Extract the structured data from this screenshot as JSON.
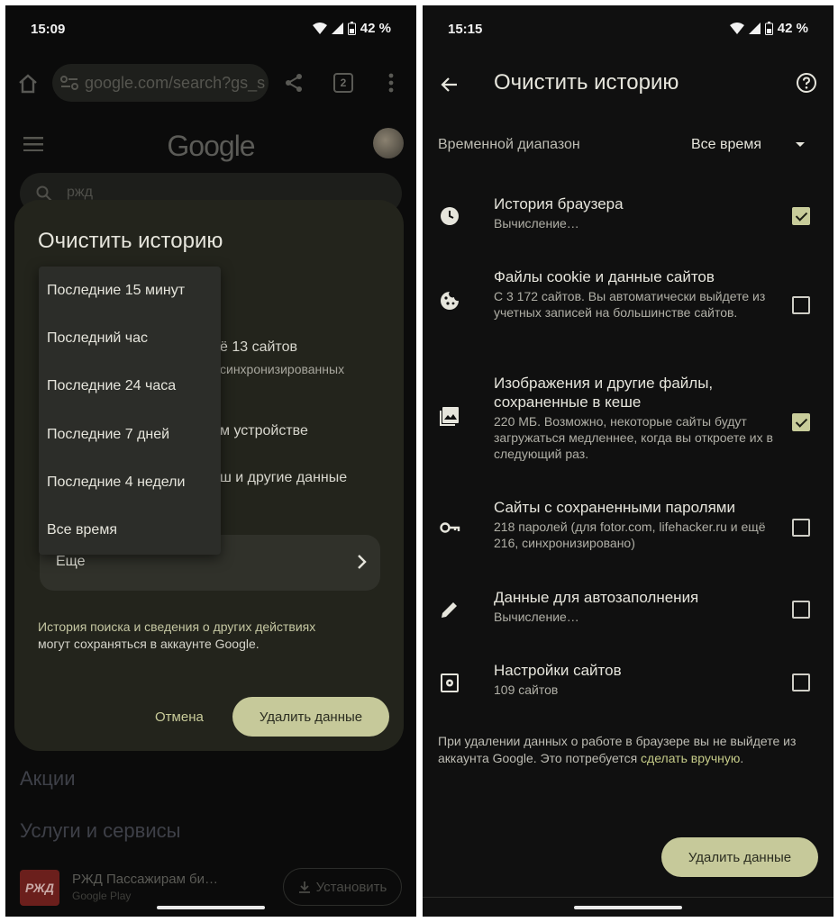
{
  "left": {
    "status": {
      "time": "15:09",
      "battery": "42 %"
    },
    "url": "google.com/search?gs_s",
    "tab_count": "2",
    "google_logo": "Google",
    "search_query": "ржд",
    "dialog": {
      "title": "Очистить историю",
      "peek_texts": [
        "ё 13 сайтов",
        "синхронизированных",
        "м устройстве",
        "ш и другие данные"
      ],
      "more_label": "Еще",
      "note_line1": "История поиска и сведения о других действиях",
      "note_line2": "могут сохраняться в аккаунте Google.",
      "cancel_label": "Отмена",
      "delete_label": "Удалить данные"
    },
    "dropdown_options": [
      "Последние 15 минут",
      "Последний час",
      "Последние 24 часа",
      "Последние 7 дней",
      "Последние 4 недели",
      "Все время"
    ],
    "sections": [
      "Акции",
      "Услуги и сервисы"
    ],
    "app_card": {
      "logo_text": "РЖД",
      "title": "РЖД Пассажирам би…",
      "subtitle": "Google Play",
      "install_label": "Установить"
    }
  },
  "right": {
    "status": {
      "time": "15:15",
      "battery": "42 %"
    },
    "title": "Очистить историю",
    "range_label": "Временной диапазон",
    "range_value": "Все время",
    "items": [
      {
        "icon": "clock-icon",
        "title": "История браузера",
        "subtitle": "Вычисление…",
        "checked": true
      },
      {
        "icon": "cookie-icon",
        "title": "Файлы cookie и данные сайтов",
        "subtitle": "С 3 172 сайтов. Вы автоматически выйдете из учетных записей на большинстве сайтов.",
        "checked": false
      },
      {
        "icon": "image-icon",
        "title": "Изображения и другие файлы, сохраненные в кеше",
        "subtitle": "220 МБ. Возможно, некоторые сайты будут загружаться медленнее, когда вы откроете их в следующий раз.",
        "checked": true
      },
      {
        "icon": "key-icon",
        "title": "Сайты с сохраненными паролями",
        "subtitle": "218 паролей (для fotor.com, lifehacker.ru и ещё 216, синхронизировано)",
        "checked": false
      },
      {
        "icon": "pencil-icon",
        "title": "Данные для автозаполнения",
        "subtitle": "Вычисление…",
        "checked": false
      },
      {
        "icon": "site-settings-icon",
        "title": "Настройки сайтов",
        "subtitle": "109 сайтов",
        "checked": false
      }
    ],
    "footnote_text": "При удалении данных о работе в браузере вы не выйдете из аккаунта Google. Это потребуется ",
    "footnote_link": "сделать вручную",
    "footnote_end": ".",
    "delete_label": "Удалить данные"
  },
  "colors": {
    "accent": "#c6c99a",
    "dialog_bg": "#23241c",
    "background": "#101010"
  }
}
